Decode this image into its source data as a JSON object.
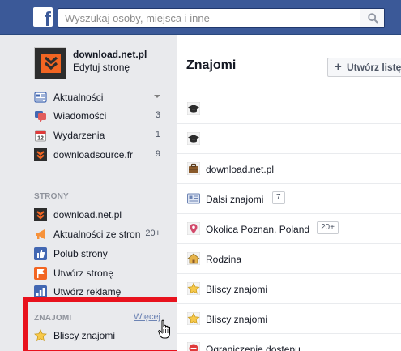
{
  "topbar": {
    "logo_letter": "f",
    "search_placeholder": "Wyszukaj osoby, miejsca i inne"
  },
  "sidebar": {
    "page": {
      "name": "download.net.pl",
      "edit_label": "Edytuj stronę"
    },
    "main_items": [
      {
        "label": "Aktualności",
        "count": "",
        "icon": "news-feed-icon"
      },
      {
        "label": "Wiadomości",
        "count": "3",
        "icon": "messages-icon"
      },
      {
        "label": "Wydarzenia",
        "count": "1",
        "icon": "events-icon"
      },
      {
        "label": "downloadsource.fr",
        "count": "9",
        "icon": "page-logo-icon"
      }
    ],
    "pages_section": {
      "header": "STRONY",
      "items": [
        {
          "label": "download.net.pl",
          "count": "",
          "icon": "page-logo-icon"
        },
        {
          "label": "Aktualności ze stron",
          "count": "20+",
          "icon": "megaphone-icon"
        },
        {
          "label": "Polub strony",
          "count": "",
          "icon": "like-icon"
        },
        {
          "label": "Utwórz stronę",
          "count": "",
          "icon": "flag-icon"
        },
        {
          "label": "Utwórz reklamę",
          "count": "",
          "icon": "ad-chart-icon"
        }
      ]
    },
    "friends_section": {
      "header": "ZNAJOMI",
      "more_link": "Więcej",
      "items": [
        {
          "label": "Bliscy znajomi",
          "icon": "star-icon"
        }
      ]
    }
  },
  "main": {
    "title": "Znajomi",
    "create_button": "Utwórz listę",
    "rows": [
      {
        "label": "",
        "icon": "graduation-cap-icon",
        "badge": ""
      },
      {
        "label": "",
        "icon": "graduation-cap-icon",
        "badge": ""
      },
      {
        "label": "download.net.pl",
        "icon": "briefcase-icon",
        "badge": ""
      },
      {
        "label": "Dalsi znajomi",
        "icon": "acquaintances-icon",
        "badge": "7"
      },
      {
        "label": "Okolica Poznan, Poland",
        "icon": "location-pin-icon",
        "badge": "20+"
      },
      {
        "label": "Rodzina",
        "icon": "house-icon",
        "badge": ""
      },
      {
        "label": "Bliscy znajomi",
        "icon": "star-icon",
        "badge": ""
      },
      {
        "label": "Bliscy znajomi",
        "icon": "star-icon",
        "badge": ""
      },
      {
        "label": "Ograniczenie dostępu",
        "icon": "restricted-icon",
        "badge": ""
      }
    ]
  },
  "colors": {
    "facebook_blue": "#3b5998",
    "sidebar_bg": "#e9eaed",
    "highlight_red": "#e8121d",
    "page_logo_orange": "#f26522"
  }
}
